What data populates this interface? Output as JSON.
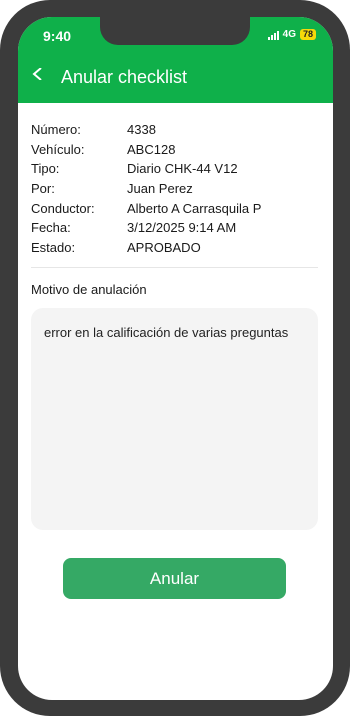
{
  "status_bar": {
    "time": "9:40",
    "network": "4G",
    "battery": "78"
  },
  "header": {
    "title": "Anular checklist",
    "back_icon": "chevron-left-icon"
  },
  "details": [
    {
      "label": "Número:",
      "value": "4338"
    },
    {
      "label": "Vehículo:",
      "value": "ABC128"
    },
    {
      "label": "Tipo:",
      "value": "Diario CHK-44 V12"
    },
    {
      "label": "Por:",
      "value": "Juan Perez"
    },
    {
      "label": "Conductor:",
      "value": "Alberto A Carrasquila P"
    },
    {
      "label": "Fecha:",
      "value": "3/12/2025 9:14 AM"
    },
    {
      "label": "Estado:",
      "value": "APROBADO"
    }
  ],
  "motivo": {
    "label": "Motivo de anulación",
    "value": "error en la calificación de varias preguntas"
  },
  "actions": {
    "anular_label": "Anular"
  },
  "colors": {
    "header": "#0fb04a",
    "button": "#35a965",
    "battery": "#f5d90a",
    "frame": "#3b3b3b"
  }
}
